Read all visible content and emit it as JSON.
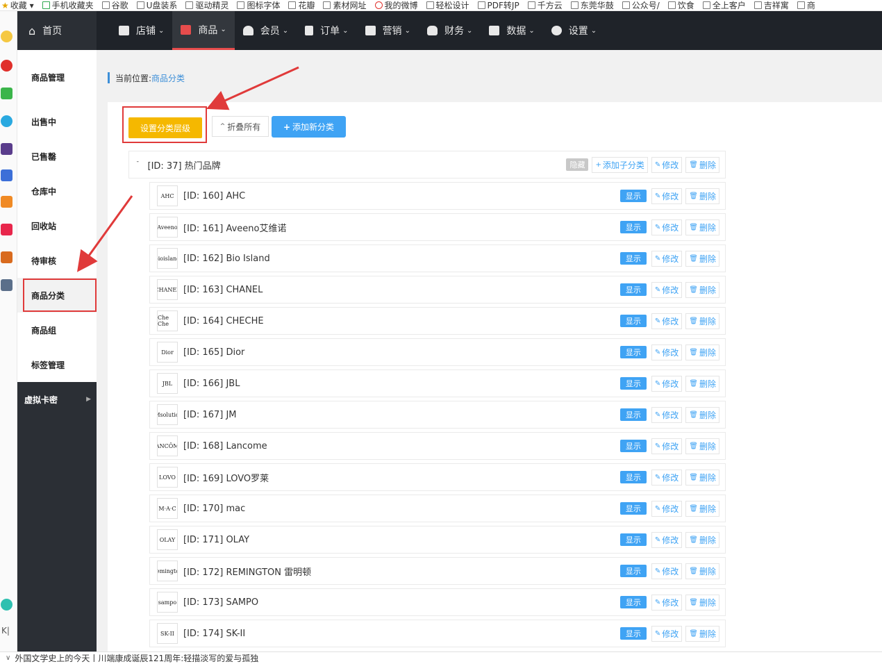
{
  "bookmarks": [
    {
      "label": "收藏 ▾",
      "icon": "star-icon"
    },
    {
      "label": "手机收藏夹",
      "icon": "phone-icon"
    },
    {
      "label": "谷歌",
      "icon": "page-icon"
    },
    {
      "label": "U盘装系",
      "icon": "page-icon"
    },
    {
      "label": "驱动精灵",
      "icon": "page-icon"
    },
    {
      "label": "图标字体",
      "icon": "page-icon"
    },
    {
      "label": "花瓣",
      "icon": "page-icon"
    },
    {
      "label": "素材网址",
      "icon": "page-icon"
    },
    {
      "label": "我的微博",
      "icon": "weibo-icon"
    },
    {
      "label": "轻松设计",
      "icon": "page-icon"
    },
    {
      "label": "PDF转JP",
      "icon": "page-icon"
    },
    {
      "label": "千方云",
      "icon": "page-icon"
    },
    {
      "label": "东莞华鼓",
      "icon": "page-icon"
    },
    {
      "label": "公众号/",
      "icon": "page-icon"
    },
    {
      "label": "饮食",
      "icon": "page-icon"
    },
    {
      "label": "全上客户",
      "icon": "page-icon"
    },
    {
      "label": "吉祥寓",
      "icon": "page-icon"
    },
    {
      "label": "商",
      "icon": "page-icon"
    }
  ],
  "topnav": {
    "home": "首页",
    "items": [
      {
        "label": "店铺",
        "icon": "store-icon",
        "active": false
      },
      {
        "label": "商品",
        "icon": "goods-icon",
        "active": true
      },
      {
        "label": "会员",
        "icon": "user-icon",
        "active": false
      },
      {
        "label": "订单",
        "icon": "order-icon",
        "active": false
      },
      {
        "label": "营销",
        "icon": "gift-icon",
        "active": false
      },
      {
        "label": "财务",
        "icon": "money-bag-icon",
        "active": false
      },
      {
        "label": "数据",
        "icon": "chart-icon",
        "active": false
      },
      {
        "label": "设置",
        "icon": "gear-icon",
        "active": false
      }
    ]
  },
  "sidebar": {
    "items": [
      {
        "label": "商品管理"
      },
      {
        "label": "出售中"
      },
      {
        "label": "已售罄"
      },
      {
        "label": "仓库中"
      },
      {
        "label": "回收站"
      },
      {
        "label": "待审核"
      },
      {
        "label": "商品分类"
      },
      {
        "label": "商品组"
      },
      {
        "label": "标签管理"
      },
      {
        "label": "虚拟卡密"
      }
    ]
  },
  "breadcrumb": {
    "prefix": "当前位置:",
    "current": "商品分类"
  },
  "toolbar": {
    "set_level": "设置分类层级",
    "collapse_all": "折叠所有",
    "add_category": "添加新分类"
  },
  "parent": {
    "label": "[ID: 37] 热门品牌",
    "status": "隐藏",
    "add_child": "添加子分类",
    "edit": "修改",
    "delete": "删除"
  },
  "row_labels": {
    "status": "显示",
    "edit": "修改",
    "delete": "删除"
  },
  "children": [
    {
      "label": "[ID: 160] AHC",
      "logo": "AHC"
    },
    {
      "label": "[ID: 161] Aveeno艾维诺",
      "logo": "Aveeno"
    },
    {
      "label": "[ID: 162] Bio Island",
      "logo": "bioisland"
    },
    {
      "label": "[ID: 163] CHANEL",
      "logo": "CHANEL"
    },
    {
      "label": "[ID: 164] CHECHE",
      "logo": "Che Che"
    },
    {
      "label": "[ID: 165] Dior",
      "logo": "Dior"
    },
    {
      "label": "[ID: 166] JBL",
      "logo": "JBL"
    },
    {
      "label": "[ID: 167] JM",
      "logo": "JMsolution"
    },
    {
      "label": "[ID: 168] Lancome",
      "logo": "LANCÔME"
    },
    {
      "label": "[ID: 169] LOVO罗莱",
      "logo": "LOVO"
    },
    {
      "label": "[ID: 170] mac",
      "logo": "M·A·C"
    },
    {
      "label": "[ID: 171] OLAY",
      "logo": "OLAY"
    },
    {
      "label": "[ID: 172] REMINGTON 雷明顿",
      "logo": "Remington"
    },
    {
      "label": "[ID: 173] SAMPO",
      "logo": "sampo"
    },
    {
      "label": "[ID: 174] SK-II",
      "logo": "SK-II"
    }
  ],
  "statusbar": {
    "text": "外国文学史上的今天丨川端康成诞辰121周年:轻描淡写的爱与孤独"
  },
  "colors": {
    "nav_bg": "#1f2329",
    "active_accent": "#e64c4c",
    "primary_blue": "#3fa3f4",
    "warning_yellow": "#f5b800",
    "highlight_red": "#e03a3a"
  }
}
